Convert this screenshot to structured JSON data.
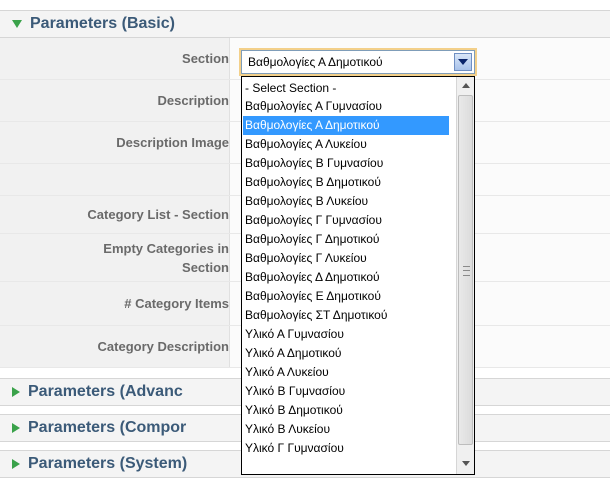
{
  "panels": {
    "basic": "Parameters (Basic)",
    "advanced": "Parameters (Advanc",
    "component": "Parameters (Compor",
    "system": "Parameters (System)"
  },
  "fields": {
    "section": "Section",
    "description": "Description",
    "description_image": "Description Image",
    "category_list_section": "Category List - Section",
    "empty_categories": "Empty Categories in Section",
    "category_items": "# Category Items",
    "category_description": "Category Description"
  },
  "select": {
    "value": "Βαθμολογίες Α Δημοτικού"
  },
  "options": [
    "- Select Section -",
    "Βαθμολογίες Α Γυμνασίου",
    "Βαθμολογίες Α Δημοτικού",
    "Βαθμολογίες Α Λυκείου",
    "Βαθμολογίες Β Γυμνασίου",
    "Βαθμολογίες Β Δημοτικού",
    "Βαθμολογίες Β Λυκείου",
    "Βαθμολογίες Γ Γυμνασίου",
    "Βαθμολογίες Γ Δημοτικού",
    "Βαθμολογίες Γ Λυκείου",
    "Βαθμολογίες Δ Δημοτικού",
    "Βαθμολογίες Ε Δημοτικού",
    "Βαθμολογίες ΣΤ Δημοτικού",
    "Υλικό Α Γυμνασίου",
    "Υλικό Α Δημοτικού",
    "Υλικό Α Λυκείου",
    "Υλικό Β Γυμνασίου",
    "Υλικό Β Δημοτικού",
    "Υλικό Β Λυκείου",
    "Υλικό Γ Γυμνασίου"
  ],
  "colors": {
    "header_text": "#3b5a78",
    "arrow": "#3aa24a",
    "selection": "#3399ff"
  }
}
